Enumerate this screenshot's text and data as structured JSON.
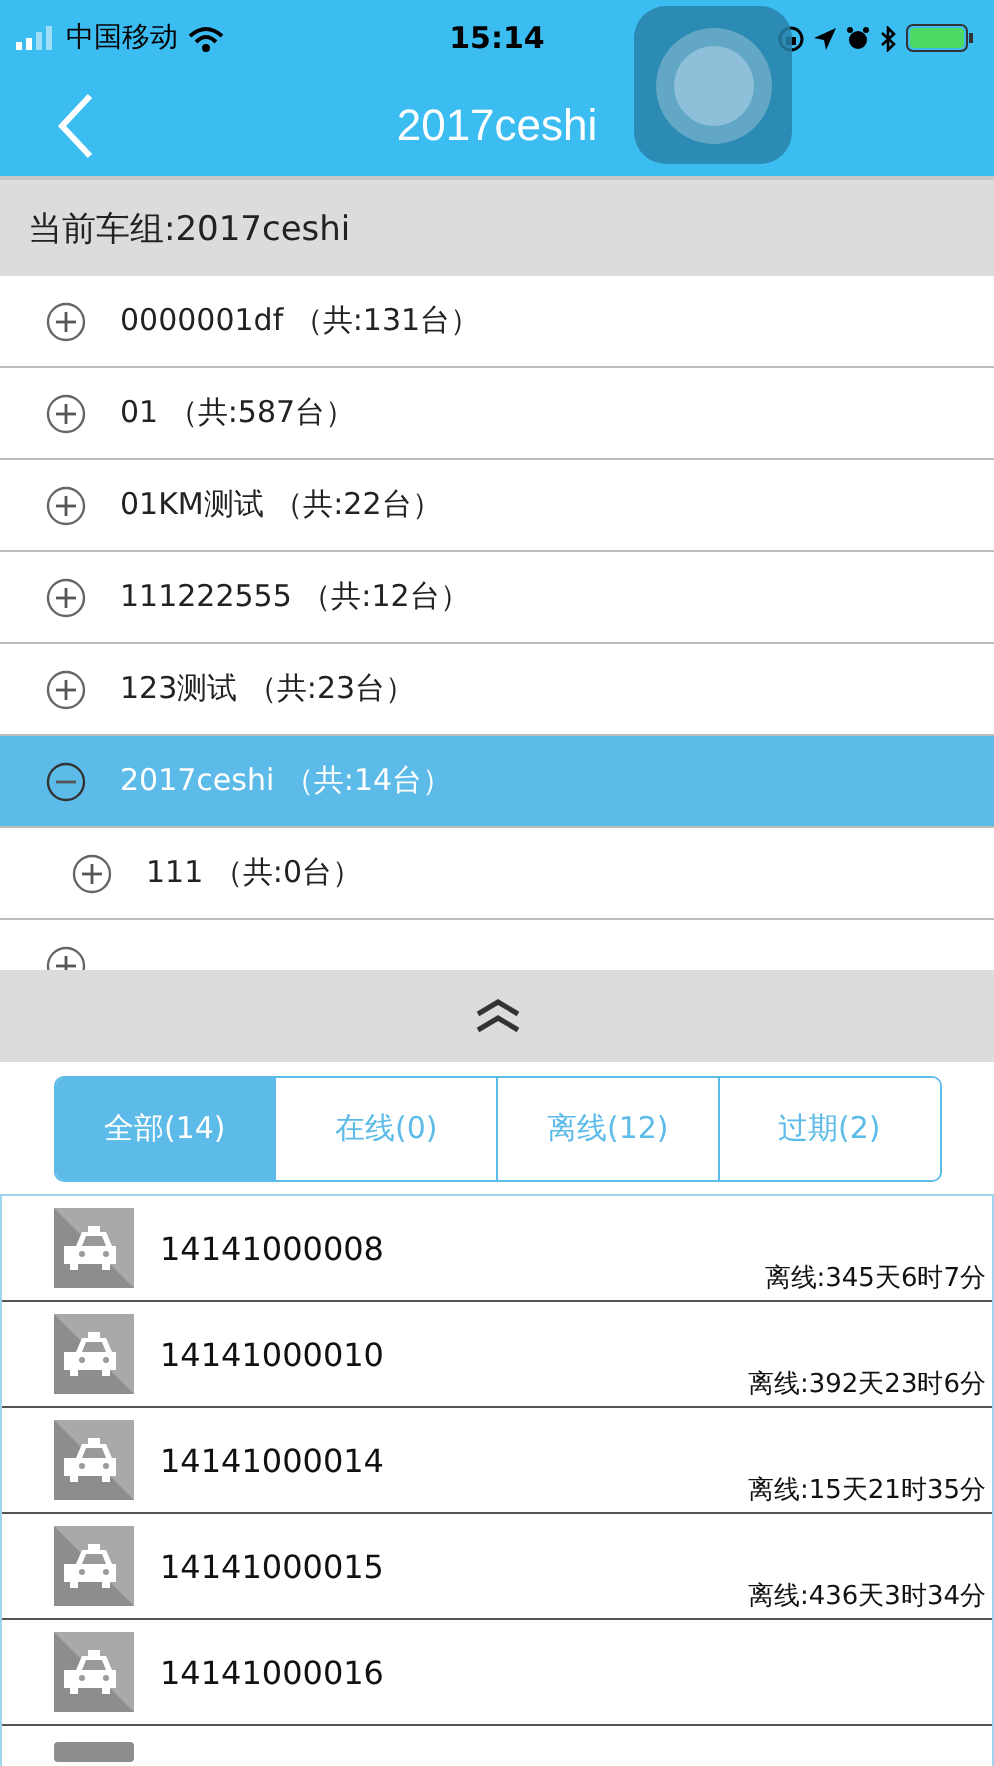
{
  "status_bar": {
    "carrier": "中国移动",
    "time": "15:14"
  },
  "nav": {
    "title": "2017ceshi"
  },
  "group_header": "当前车组:2017ceshi",
  "tree": [
    {
      "label": "0000001df （共:131台）",
      "expanded": false,
      "selected": false
    },
    {
      "label": "01 （共:587台）",
      "expanded": false,
      "selected": false
    },
    {
      "label": "01KM测试 （共:22台）",
      "expanded": false,
      "selected": false
    },
    {
      "label": "111222555 （共:12台）",
      "expanded": false,
      "selected": false
    },
    {
      "label": "123测试 （共:23台）",
      "expanded": false,
      "selected": false
    },
    {
      "label": "2017ceshi （共:14台）",
      "expanded": true,
      "selected": true,
      "children": [
        {
          "label": "111 （共:0台）",
          "expanded": false,
          "selected": false
        }
      ]
    },
    {
      "expanded": false,
      "selected": false
    }
  ],
  "filter_tabs": [
    {
      "label": "全部(14)",
      "selected": true
    },
    {
      "label": "在线(0)",
      "selected": false
    },
    {
      "label": "离线(12)",
      "selected": false
    },
    {
      "label": "过期(2)",
      "selected": false
    }
  ],
  "vehicles": [
    {
      "kind": "row",
      "id": "14141000008",
      "status": "离线:345天6时7分"
    },
    {
      "kind": "row",
      "id": "14141000010",
      "status": "离线:392天23时6分"
    },
    {
      "kind": "row",
      "id": "14141000014",
      "status": "离线:15天21时35分"
    },
    {
      "kind": "row",
      "id": "14141000015",
      "status": "离线:436天3时34分"
    },
    {
      "kind": "row",
      "id": "14141000016"
    },
    {
      "kind": "partial"
    }
  ]
}
